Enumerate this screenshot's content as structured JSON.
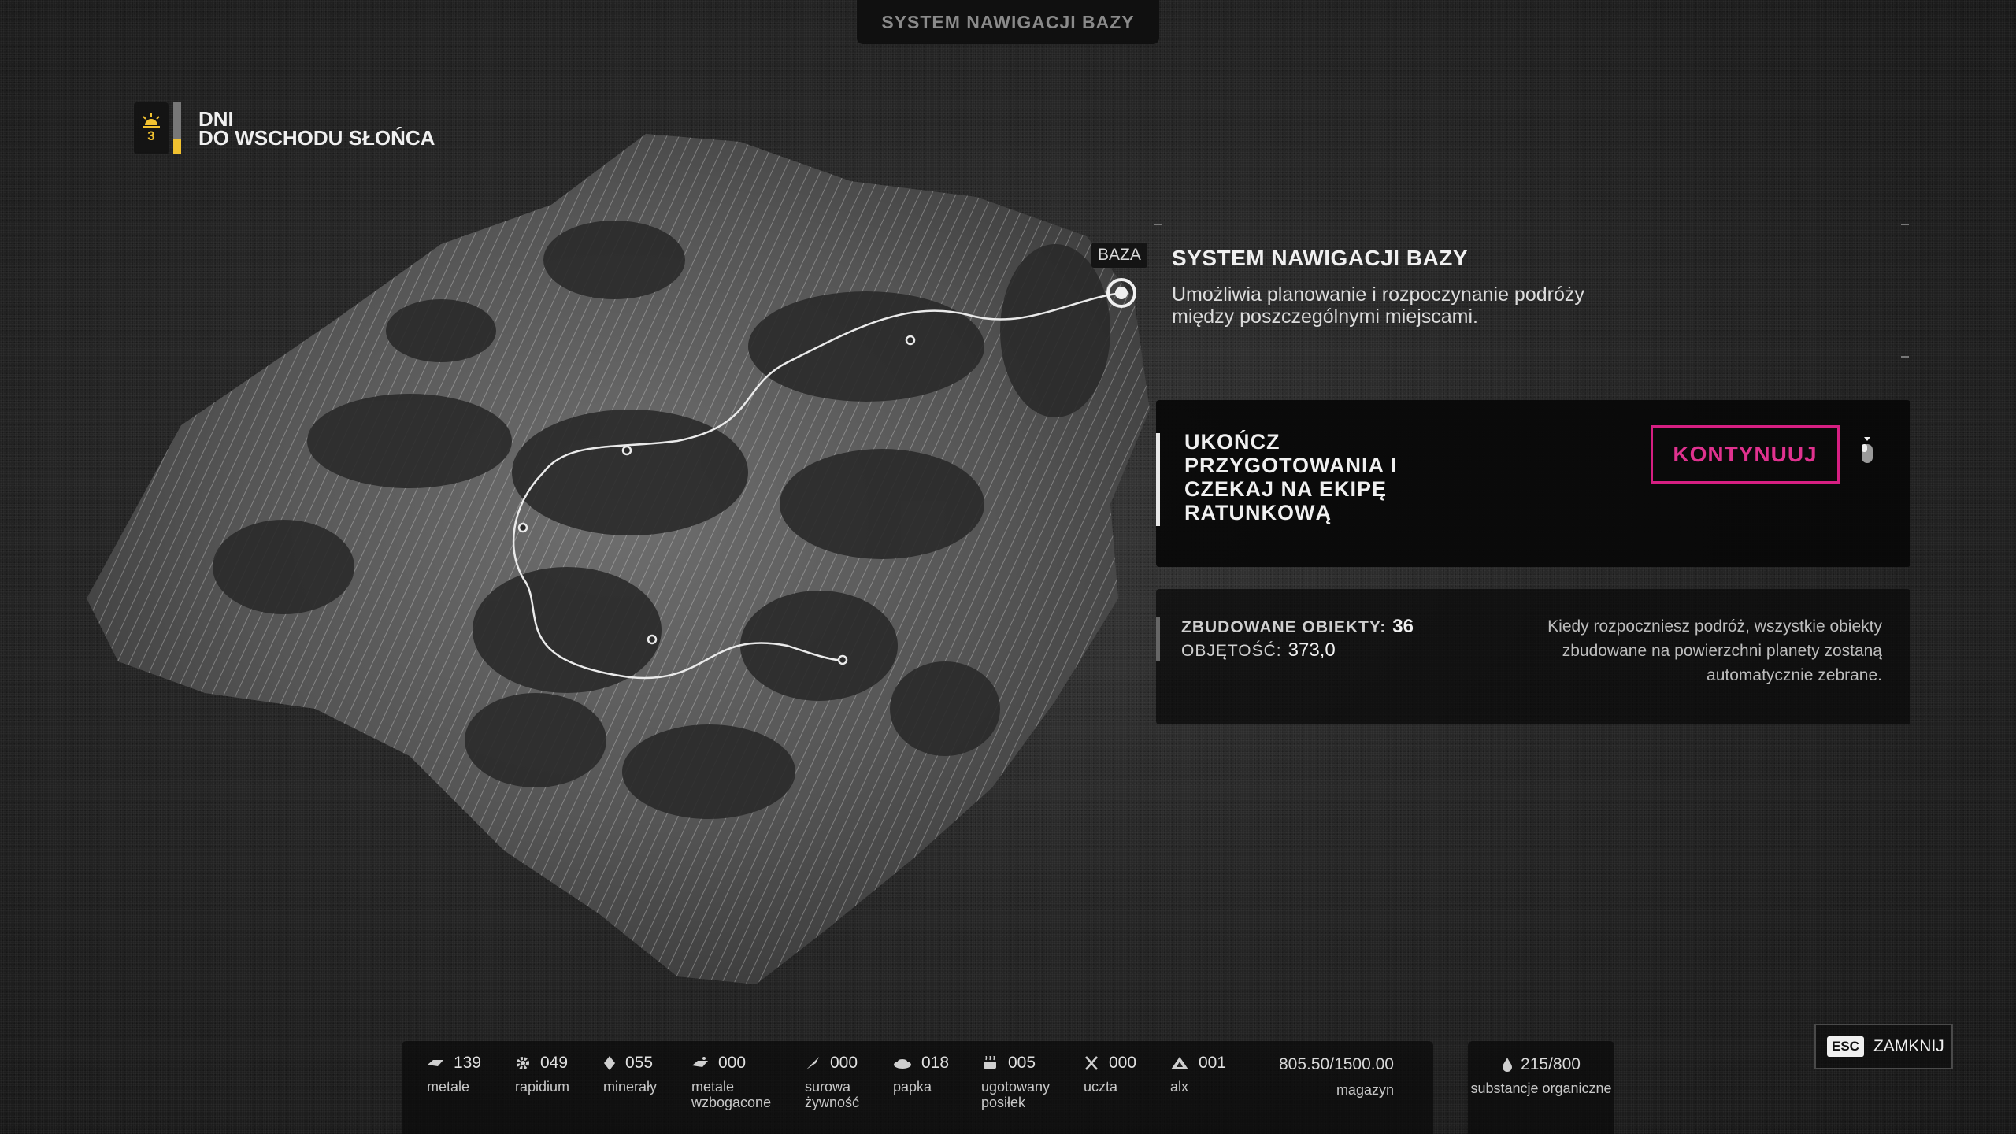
{
  "top_tab": {
    "title": "SYSTEM NAWIGACJI BAZY"
  },
  "days": {
    "count": "3",
    "line1": "DNI",
    "line2": "DO WSCHODU SŁOŃCA",
    "accent": "#f2c230"
  },
  "map": {
    "base_label": "BAZA"
  },
  "info": {
    "title": "SYSTEM NAWIGACJI BAZY",
    "description": "Umożliwia planowanie i rozpoczynanie podróży między poszczególnymi miejscami."
  },
  "objective": {
    "text": "UKOŃCZ PRZYGOTOWANIA I CZEKAJ NA EKIPĘ RATUNKOWĄ",
    "continue_label": "KONTYNUUJ",
    "continue_color": "#d61f82",
    "mouse_icon": "mouse-icon"
  },
  "stats": {
    "built_label": "ZBUDOWANE OBIEKTY:",
    "built_value": "36",
    "volume_label": "OBJĘTOŚĆ:",
    "volume_value": "373,0",
    "note": "Kiedy rozpoczniesz podróż, wszystkie obiekty zbudowane na powierzchni planety zostaną automatycznie zebrane."
  },
  "resources": [
    {
      "icon": "metal-icon",
      "value": "139",
      "label": "metale"
    },
    {
      "icon": "gear-icon",
      "value": "049",
      "label": "rapidium"
    },
    {
      "icon": "crystal-icon",
      "value": "055",
      "label": "minerały"
    },
    {
      "icon": "enriched-metal-icon",
      "value": "000",
      "label": "metale wzbogacone"
    },
    {
      "icon": "raw-food-icon",
      "value": "000",
      "label": "surowa żywność"
    },
    {
      "icon": "mush-icon",
      "value": "018",
      "label": "papka"
    },
    {
      "icon": "cooked-meal-icon",
      "value": "005",
      "label": "ugotowany posiłek"
    },
    {
      "icon": "feast-icon",
      "value": "000",
      "label": "uczta"
    },
    {
      "icon": "alx-icon",
      "value": "001",
      "label": "alx"
    }
  ],
  "storage": {
    "value": "805.50/1500.00",
    "label": "magazyn"
  },
  "organic": {
    "value": "215/800",
    "label": "substancje organiczne"
  },
  "close": {
    "key": "ESC",
    "label": "ZAMKNIJ"
  }
}
